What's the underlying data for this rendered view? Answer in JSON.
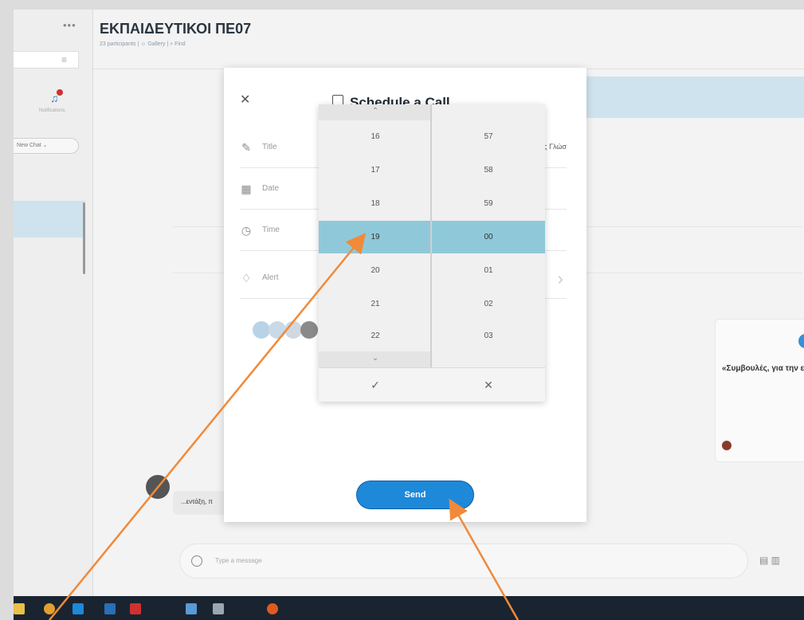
{
  "chat": {
    "title": "ΕΚΠΑΙΔΕΥΤΙΚΟΙ ΠΕ07",
    "subtitle": "23 participants | ☺ Gallery | ⌕ Find"
  },
  "sidebar": {
    "new_chat": "New Chat ⌄",
    "notifications_label": "Notifications"
  },
  "modal": {
    "close_icon": "close-icon",
    "title": "Schedule a Call",
    "rows": {
      "title_label": "Title",
      "title_value": "ς Γλώσ",
      "date_label": "Date",
      "time_label": "Time",
      "alert_label": "Alert"
    },
    "send_label": "Send"
  },
  "time_picker": {
    "hours": [
      "16",
      "17",
      "18",
      "19",
      "20",
      "21",
      "22"
    ],
    "minutes": [
      "57",
      "58",
      "59",
      "00",
      "01",
      "02",
      "03"
    ],
    "selected_hour": "19",
    "selected_minute": "00",
    "confirm_icon": "✓",
    "cancel_icon": "✕"
  },
  "background": {
    "card_title": "«Συμβουλές, για την εξ απ",
    "bubble_text": "...εντάξη, π",
    "composer_placeholder": "Type a message"
  },
  "colors": {
    "accent": "#1e88d9",
    "selection": "#8fc9d9",
    "annotation_arrow": "#f08a3a"
  }
}
